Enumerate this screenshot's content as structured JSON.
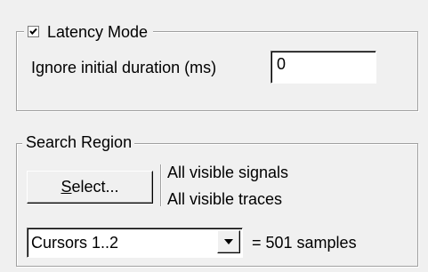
{
  "latency": {
    "caption": "Latency Mode",
    "checked": true,
    "ignore_label": "Ignore initial duration (ms)",
    "ignore_value": "0"
  },
  "search": {
    "caption": "Search Region",
    "select_prefix": "S",
    "select_rest": "elect...",
    "signals_text": "All visible signals",
    "traces_text": "All visible traces",
    "combo_value": "Cursors 1..2",
    "samples_text": "= 501 samples"
  },
  "icons": {
    "checkbox_check": "check-icon",
    "combo_arrow": "dropdown-arrow-icon"
  }
}
